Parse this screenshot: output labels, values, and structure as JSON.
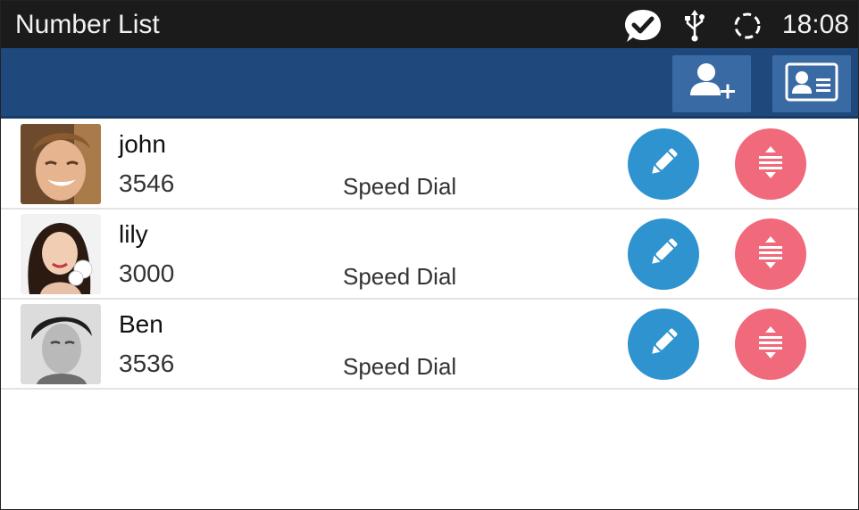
{
  "statusbar": {
    "title": "Number List",
    "time": "18:08",
    "icons": [
      "chat-check-icon",
      "usb-icon",
      "sync-icon"
    ]
  },
  "toolbar": {
    "add_contact_icon": "add-contact-icon",
    "contacts_icon": "contact-card-icon"
  },
  "colors": {
    "status_bar": "#1b1b1b",
    "toolbar": "#1f497d",
    "toolbar_button": "#3a6aa3",
    "edit": "#2f93cf",
    "delete": "#f06a7c"
  },
  "contacts": [
    {
      "name": "john",
      "number": "3546",
      "badge": "Speed Dial"
    },
    {
      "name": "lily",
      "number": "3000",
      "badge": "Speed Dial"
    },
    {
      "name": "Ben",
      "number": "3536",
      "badge": "Speed Dial"
    }
  ]
}
